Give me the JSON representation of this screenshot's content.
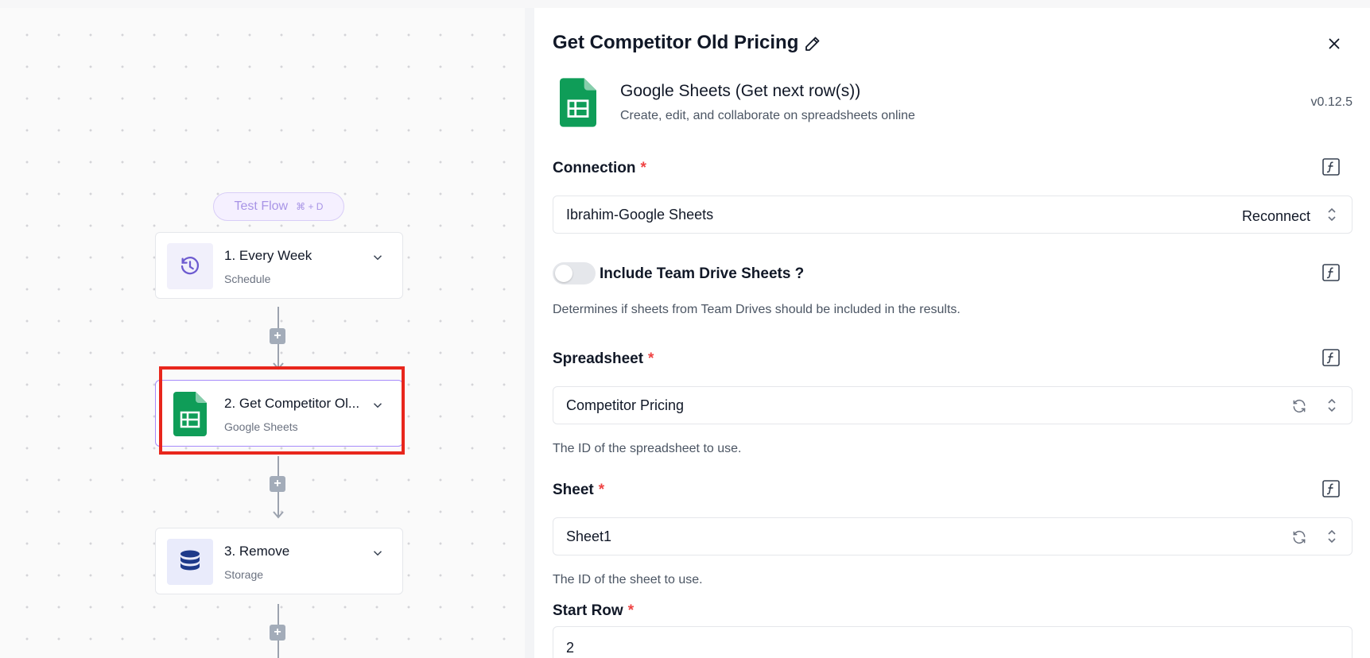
{
  "canvas": {
    "test_flow": {
      "label": "Test Flow",
      "shortcut": "⌘ + D"
    },
    "steps": [
      {
        "title": "1. Every Week",
        "subtitle": "Schedule",
        "icon": "clock-icon"
      },
      {
        "title": "2. Get Competitor Ol...",
        "subtitle": "Google Sheets",
        "icon": "google-sheets-icon",
        "selected": true
      },
      {
        "title": "3. Remove",
        "subtitle": "Storage",
        "icon": "database-icon"
      }
    ],
    "add_step_symbol": "+"
  },
  "panel": {
    "title": "Get Competitor Old Pricing",
    "app": {
      "name": "Google Sheets (Get next row(s))",
      "description": "Create, edit, and collaborate on spreadsheets online",
      "version": "v0.12.5"
    },
    "fields": {
      "connection": {
        "label": "Connection",
        "required_mark": "*",
        "value": "Ibrahim-Google Sheets",
        "action": "Reconnect"
      },
      "team_drive": {
        "label": "Include Team Drive Sheets ?",
        "enabled": false,
        "help": "Determines if sheets from Team Drives should be included in the results."
      },
      "spreadsheet": {
        "label": "Spreadsheet",
        "required_mark": "*",
        "value": "Competitor Pricing",
        "help": "The ID of the spreadsheet to use."
      },
      "sheet": {
        "label": "Sheet",
        "required_mark": "*",
        "value": "Sheet1",
        "help": "The ID of the sheet to use."
      },
      "start_row": {
        "label": "Start Row",
        "required_mark": "*",
        "value": "2"
      }
    }
  },
  "colors": {
    "accent_purple": "#a78bfa",
    "highlight_red": "#e8261c",
    "sheets_green": "#0f9d58",
    "required_red": "#ef4444"
  }
}
